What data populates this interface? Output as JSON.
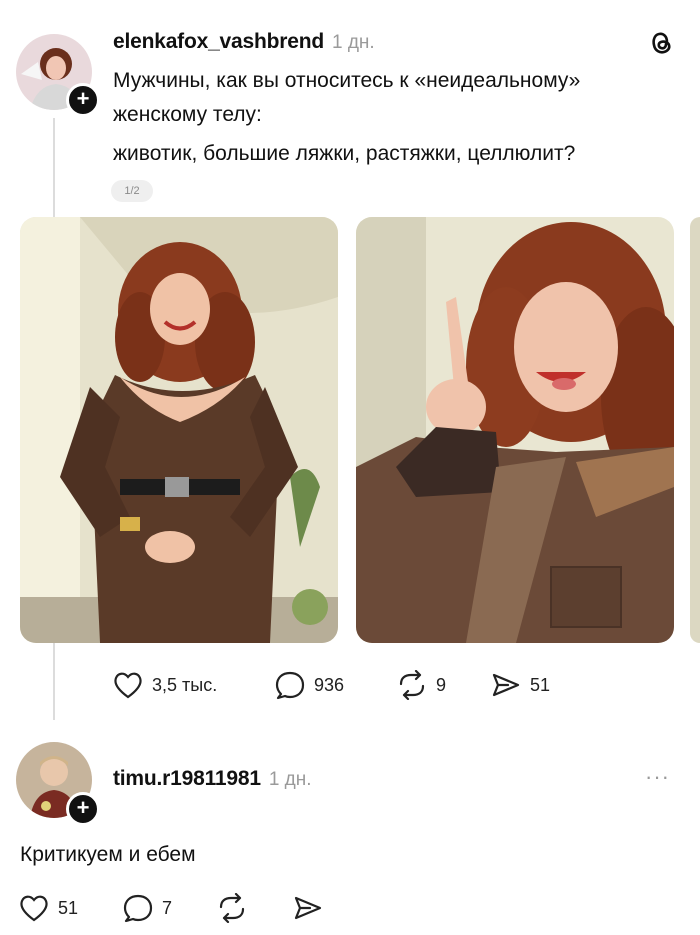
{
  "post": {
    "username": "elenkafox_vashbrend",
    "time": "1 дн.",
    "text_line1": "Мужчины, как вы относитесь к «неидеальному»",
    "text_line2": "женскому телу:",
    "text_line3": "животик, большие ляжки, растяжки, целлюлит?",
    "page_indicator": "1/2",
    "app_icon": "threads-icon",
    "actions": {
      "likes": "3,5 тыс.",
      "comments": "936",
      "reposts": "9",
      "shares": "51"
    }
  },
  "reply": {
    "username": "timu.r19811981",
    "time": "1 дн.",
    "text": "Критикуем и ебем",
    "more": "···",
    "actions": {
      "likes": "51",
      "comments": "7"
    }
  },
  "colors": {
    "text": "#111111",
    "muted": "#9a9a9a",
    "line": "#dcdcdc",
    "dress": "#5a3a28",
    "hair": "#8a3a1e",
    "wall": "#e8e4cf"
  }
}
